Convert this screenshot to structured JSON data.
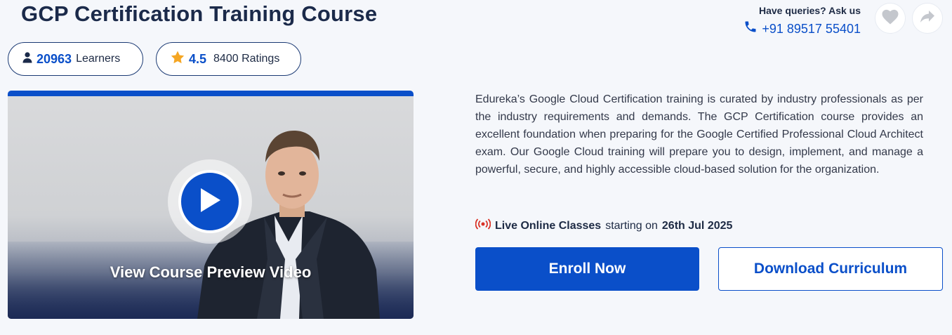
{
  "course": {
    "title": "GCP Certification Training Course"
  },
  "contact": {
    "label": "Have queries? Ask us",
    "phone": "+91 89517 55401",
    "phone_icon": "phone-icon"
  },
  "actions": {
    "wishlist_icon": "heart-icon",
    "share_icon": "share-icon"
  },
  "stats": {
    "learners_count": "20963",
    "learners_label": "Learners",
    "rating_value": "4.5",
    "ratings_label": "8400 Ratings"
  },
  "video": {
    "caption": "View Course Preview Video",
    "play_icon": "play-icon"
  },
  "description": "Edureka’s Google Cloud Certification training is curated by industry professionals as per the industry requirements and demands. The GCP Certification course provides an excellent foundation when preparing for the Google Certified Professional Cloud Architect exam. Our Google Cloud training will prepare you to design, implement, and manage a powerful, secure, and highly accessible cloud-based solution for the organization.",
  "live_classes": {
    "title": "Live Online Classes",
    "middle": "starting on",
    "date": "26th Jul 2025"
  },
  "buttons": {
    "enroll": "Enroll Now",
    "download": "Download Curriculum"
  },
  "colors": {
    "primary": "#0a4fc9",
    "title": "#1b2a4a",
    "star": "#f5a623",
    "live": "#d93025"
  }
}
